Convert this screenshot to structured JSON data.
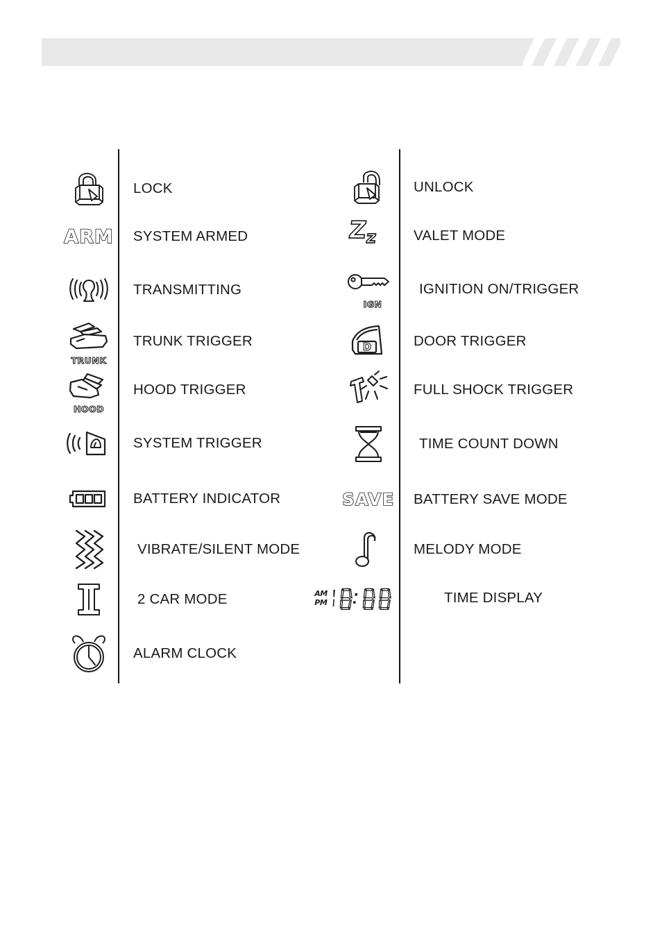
{
  "page": {
    "background": "#ffffff",
    "header_band_color": "#e9e9e9",
    "ink_color": "#1a1a1a"
  },
  "legend": {
    "left_column": [
      {
        "icon": "padlock-closed-icon",
        "label": "LOCK"
      },
      {
        "icon": "arm-text-icon",
        "icon_text": "ARM",
        "label": "SYSTEM ARMED"
      },
      {
        "icon": "antenna-transmitting-icon",
        "label": "TRANSMITTING"
      },
      {
        "icon": "car-trunk-open-icon",
        "icon_text": "TRUNK",
        "label": "TRUNK TRIGGER"
      },
      {
        "icon": "car-hood-open-icon",
        "icon_text": "HOOD",
        "label": "HOOD TRIGGER"
      },
      {
        "icon": "siren-speaker-icon",
        "label": "SYSTEM TRIGGER"
      },
      {
        "icon": "battery-three-bars-icon",
        "label": "BATTERY INDICATOR"
      },
      {
        "icon": "vibrate-zigzag-icon",
        "label": "VIBRATE/SILENT MODE"
      },
      {
        "icon": "roman-numeral-two-icon",
        "label": "2 CAR MODE"
      },
      {
        "icon": "alarm-clock-icon",
        "label": "ALARM CLOCK"
      }
    ],
    "right_column": [
      {
        "icon": "padlock-open-icon",
        "label": "UNLOCK"
      },
      {
        "icon": "zz-sleep-icon",
        "icon_text_big": "Z",
        "icon_text_small": "z",
        "label": "VALET MODE"
      },
      {
        "icon": "ignition-key-icon",
        "icon_text": "IGN",
        "label": "IGNITION ON/TRIGGER"
      },
      {
        "icon": "car-door-icon",
        "icon_text": "D",
        "label": "DOOR TRIGGER"
      },
      {
        "icon": "shock-hammer-impact-icon",
        "label": "FULL SHOCK TRIGGER"
      },
      {
        "icon": "hourglass-icon",
        "label": "TIME COUNT DOWN"
      },
      {
        "icon": "save-text-icon",
        "icon_text": "SAVE",
        "label": "BATTERY SAVE MODE"
      },
      {
        "icon": "music-note-icon",
        "label": "MELODY MODE"
      },
      {
        "icon": "lcd-time-display-icon",
        "label": "TIME DISPLAY"
      }
    ]
  },
  "lcd_display": {
    "am_label": "AM",
    "pm_label": "PM",
    "digits": "18:88"
  }
}
